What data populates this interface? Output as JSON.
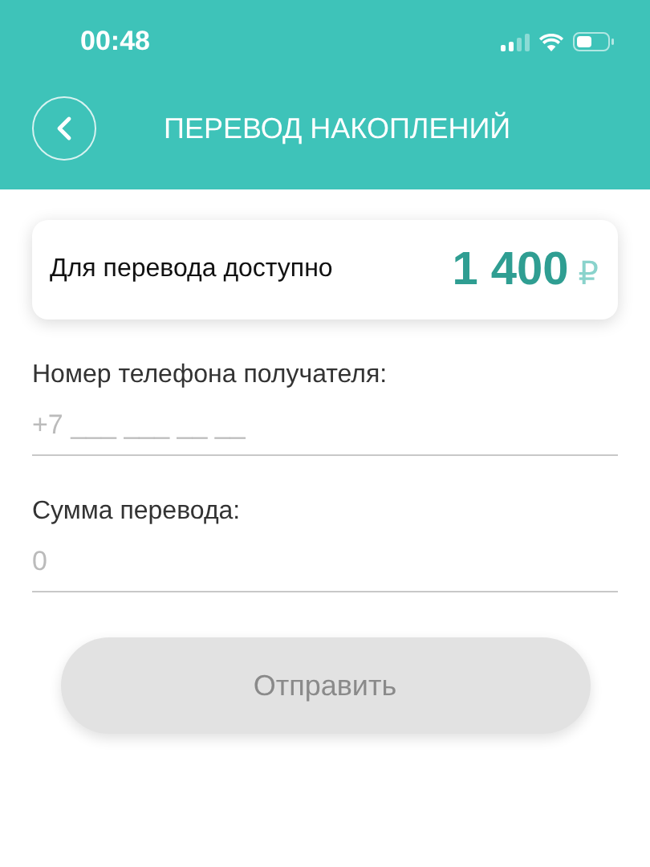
{
  "status_bar": {
    "time": "00:48"
  },
  "header": {
    "title": "ПЕРЕВОД НАКОПЛЕНИЙ"
  },
  "balance_card": {
    "label": "Для перевода доступно",
    "amount": "1 400",
    "currency": "₽"
  },
  "fields": [
    {
      "label": "Номер телефона получателя:",
      "placeholder": "+7 ___ ___ __ __"
    },
    {
      "label": "Сумма перевода:",
      "placeholder": "0"
    }
  ],
  "submit_button": {
    "label": "Отправить",
    "disabled": true
  }
}
